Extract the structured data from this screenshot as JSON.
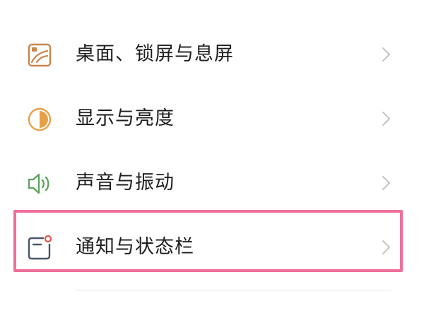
{
  "settings": {
    "items": [
      {
        "label": "桌面、锁屏与息屏",
        "icon": "wallpaper-icon"
      },
      {
        "label": "显示与亮度",
        "icon": "brightness-icon"
      },
      {
        "label": "声音与振动",
        "icon": "speaker-icon"
      },
      {
        "label": "通知与状态栏",
        "icon": "notification-icon",
        "highlighted": true
      }
    ]
  },
  "colors": {
    "highlight_border": "#ee6f9a",
    "wallpaper_icon": "#c9854a",
    "brightness_icon": "#e8a047",
    "speaker_icon": "#5aa35c",
    "notification_icon": "#4a5568",
    "notification_dot": "#e5534b",
    "chevron": "#c4c4c4"
  }
}
